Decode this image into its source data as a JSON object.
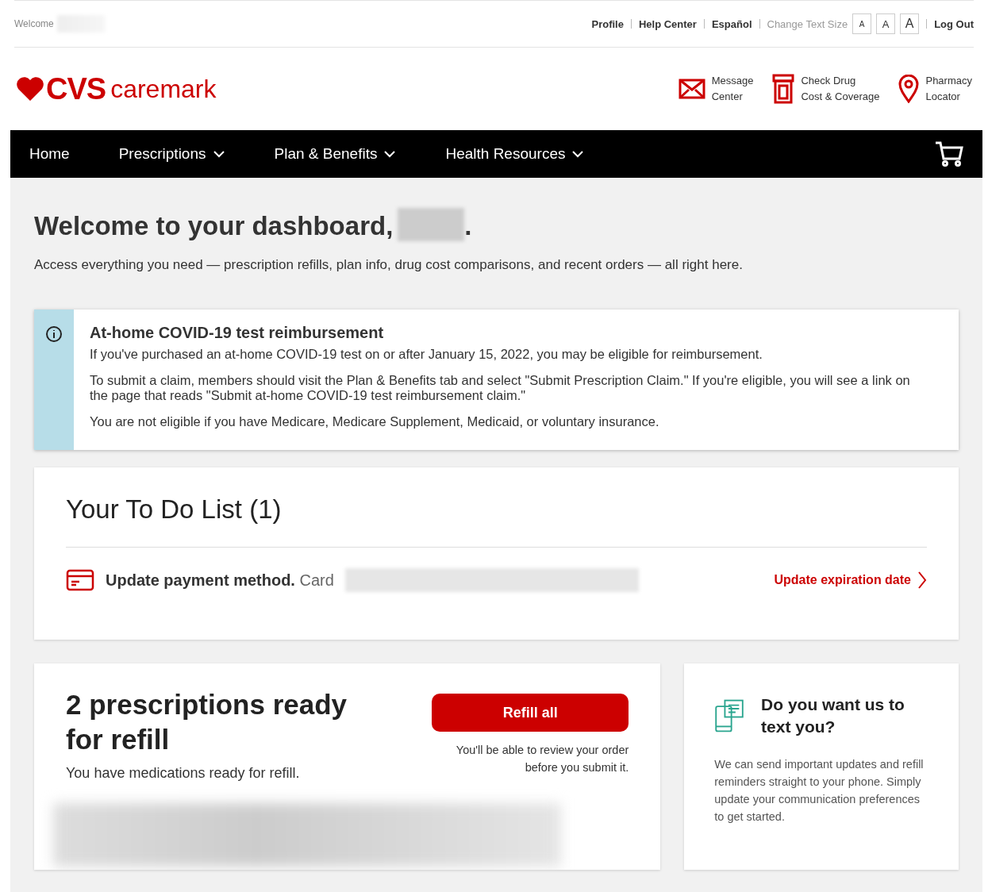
{
  "top_bar": {
    "welcome": "Welcome",
    "links": [
      "Profile",
      "Help Center",
      "Español"
    ],
    "text_size_label": "Change Text Size",
    "text_sizes": [
      "A",
      "A",
      "A"
    ],
    "logout": "Log Out"
  },
  "header": {
    "logo": {
      "brand": "CVS",
      "name": "caremark"
    },
    "quick_links": [
      {
        "kind": "mail",
        "label": "Message Center"
      },
      {
        "kind": "drug",
        "label": "Check Drug Cost & Coverage"
      },
      {
        "kind": "pin",
        "label": "Pharmacy Locator"
      }
    ]
  },
  "nav": {
    "items": [
      {
        "label": "Home",
        "has_menu": false
      },
      {
        "label": "Prescriptions",
        "has_menu": true
      },
      {
        "label": "Plan & Benefits",
        "has_menu": true
      },
      {
        "label": "Health Resources",
        "has_menu": true
      }
    ]
  },
  "dashboard": {
    "title": "Welcome to your dashboard,",
    "title_end": ".",
    "subtitle": "Access everything you need — prescription refills, plan info, drug cost comparisons, and recent orders — all right here."
  },
  "alert": {
    "title": "At-home COVID-19 test reimbursement",
    "paragraphs": [
      "If you've purchased an at-home COVID-19 test on or after January 15, 2022, you may be eligible for reimbursement.",
      "To submit a claim, members should visit the Plan & Benefits tab and select \"Submit Prescription Claim.\" If you're eligible, you will see a link on the page that reads \"Submit at-home COVID-19 test reimbursement claim.\"",
      "You are not eligible if you have Medicare, Medicare Supplement, Medicaid, or voluntary insurance."
    ]
  },
  "todo": {
    "title": "Your To Do List (1)",
    "items": [
      {
        "text": "**Update payment method.** Card",
        "action": "Update expiration date"
      }
    ]
  },
  "refill": {
    "title": "2 prescriptions ready for refill",
    "subtitle": "You have medications ready for refill.",
    "button": "Refill all",
    "note": "You'll be able to review your order before you submit it."
  },
  "text_promo": {
    "title": "Do you want us to text you?",
    "body": "We can send important updates and refill reminders straight to your phone. Simply update your communication preferences to get started."
  }
}
